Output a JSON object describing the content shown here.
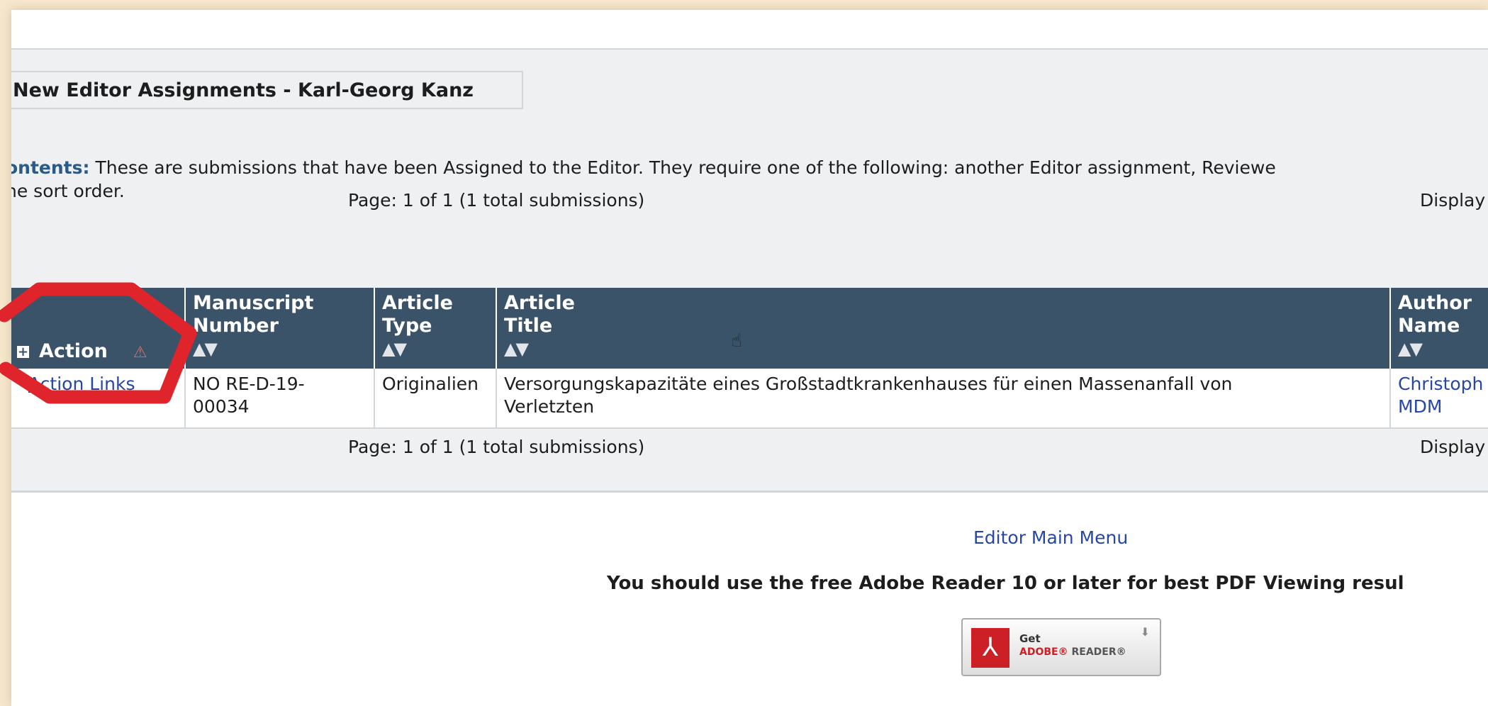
{
  "panel": {
    "legend": "New Editor Assignments - Karl-Georg Kanz",
    "contents_label": "ontents:",
    "contents_text": " These are submissions that have been Assigned to the Editor. They require one of the following: another Editor assignment, Reviewe",
    "contents_text_2": "ne sort order."
  },
  "pager_top": {
    "text": "Page: 1 of 1 (1 total submissions)",
    "display": "Display"
  },
  "pager_bottom": {
    "text": "Page: 1 of 1 (1 total submissions)",
    "display": "Display"
  },
  "table": {
    "headers": {
      "action": "Action",
      "manuscript_number": [
        "Manuscript",
        "Number"
      ],
      "article_type": [
        "Article",
        "Type"
      ],
      "article_title": [
        "Article",
        "Title"
      ],
      "author_name": [
        "Author",
        "Name"
      ]
    },
    "sort_glyph": "▲▼",
    "plus_glyph": "+",
    "warn_glyph": "⚠",
    "rows": [
      {
        "action_link": "Action Links",
        "manuscript_number_line1": "NO RE-D-19-",
        "manuscript_number_line2": "00034",
        "article_type": "Originalien",
        "article_title_line1": "Versorgungskapazitäte  eines Großstadtkrankenhauses für einen Massenanfall von",
        "article_title_line2": "Verletzten",
        "author_line1": "Christoph",
        "author_line2": "MDM"
      }
    ]
  },
  "footer": {
    "menu_link": "Editor Main Menu",
    "advice": "You should use the free Adobe Reader 10 or later for best PDF Viewing resul",
    "reader_badge": {
      "get": "Get",
      "brand": "ADOBE®",
      "product": "READER®",
      "icon": "adobe-pdf-icon"
    }
  },
  "colors": {
    "header_bg": "#3a5368",
    "panel_bg": "#eef0f1",
    "link": "#2646a8",
    "annotation": "#e0242c",
    "outer_bg": "#f6e7cd"
  }
}
